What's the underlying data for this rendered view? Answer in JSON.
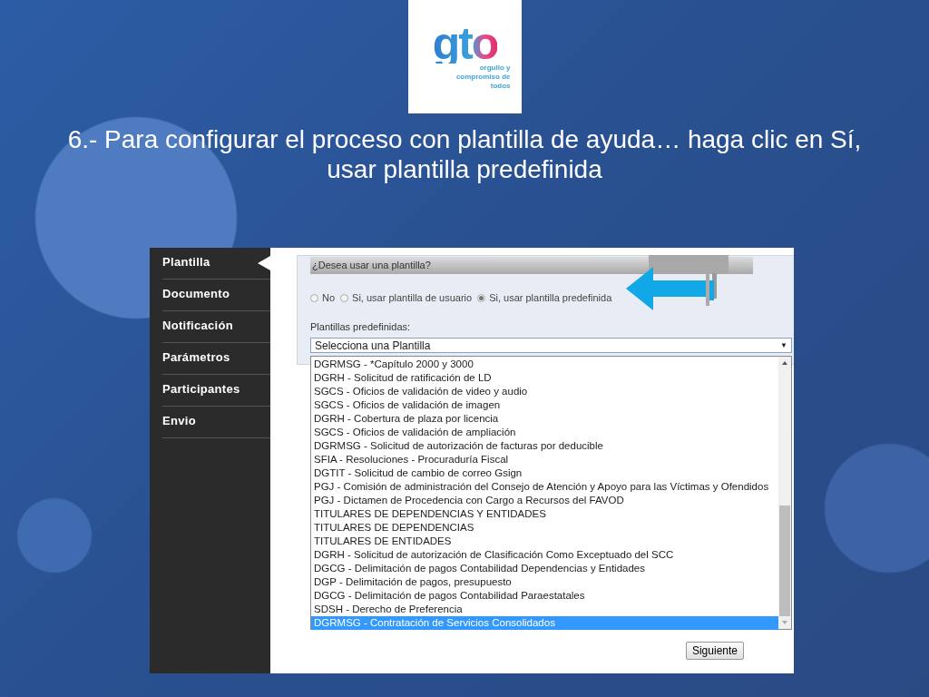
{
  "slide": {
    "logo": {
      "wordmark": "gto",
      "tagline": "orgullo y compromiso de todos"
    },
    "title": "6.- Para configurar el proceso con plantilla de ayuda… haga clic en Sí, usar plantilla predefinida"
  },
  "sidebar": {
    "items": [
      {
        "label": "Plantilla",
        "selected": true
      },
      {
        "label": "Documento",
        "selected": false
      },
      {
        "label": "Notificación",
        "selected": false
      },
      {
        "label": "Parámetros",
        "selected": false
      },
      {
        "label": "Participantes",
        "selected": false
      },
      {
        "label": "Envio",
        "selected": false
      }
    ]
  },
  "panel": {
    "header": "¿Desea usar una plantilla?",
    "radios": [
      {
        "label": "No",
        "selected": false
      },
      {
        "label": "Si, usar plantilla de usuario",
        "selected": false
      },
      {
        "label": "Si, usar plantilla predefinida",
        "selected": true
      }
    ],
    "select_label": "Plantillas predefinidas:",
    "select": {
      "value": "Selecciona una Plantilla",
      "arrow": "▼"
    }
  },
  "dropdown": {
    "options": [
      {
        "label": "DGRMSG - *Capítulo 2000 y 3000",
        "selected": false
      },
      {
        "label": "DGRH - Solicitud de ratificación de LD",
        "selected": false
      },
      {
        "label": "SGCS - Oficios de validación de video y audio",
        "selected": false
      },
      {
        "label": "SGCS - Oficios de validación de imagen",
        "selected": false
      },
      {
        "label": "DGRH - Cobertura de plaza por licencia",
        "selected": false
      },
      {
        "label": "SGCS - Oficios de validación de ampliación",
        "selected": false
      },
      {
        "label": "DGRMSG - Solicitud de autorización de facturas por deducible",
        "selected": false
      },
      {
        "label": "SFIA - Resoluciones - Procuraduría Fiscal",
        "selected": false
      },
      {
        "label": "DGTIT - Solicitud de cambio de correo Gsign",
        "selected": false
      },
      {
        "label": "PGJ - Comisión de administración del Consejo de Atención y Apoyo para las Víctimas y Ofendidos",
        "selected": false
      },
      {
        "label": "PGJ - Dictamen de Procedencia con Cargo a Recursos del FAVOD",
        "selected": false
      },
      {
        "label": "TITULARES DE DEPENDENCIAS Y ENTIDADES",
        "selected": false
      },
      {
        "label": "TITULARES DE DEPENDENCIAS",
        "selected": false
      },
      {
        "label": "TITULARES DE ENTIDADES",
        "selected": false
      },
      {
        "label": "DGRH - Solicitud de autorización de Clasificación Como Exceptuado del SCC",
        "selected": false
      },
      {
        "label": "DGCG - Delimitación de pagos Contabilidad Dependencias y Entidades",
        "selected": false
      },
      {
        "label": "DGP - Delimitación de pagos, presupuesto",
        "selected": false
      },
      {
        "label": "DGCG - Delimitación de pagos Contabilidad Paraestatales",
        "selected": false
      },
      {
        "label": "SDSH - Derecho de Preferencia",
        "selected": false
      },
      {
        "label": "DGRMSG - Contratación de Servicios Consolidados",
        "selected": true
      }
    ]
  },
  "buttons": [
    "Siguiente"
  ]
}
